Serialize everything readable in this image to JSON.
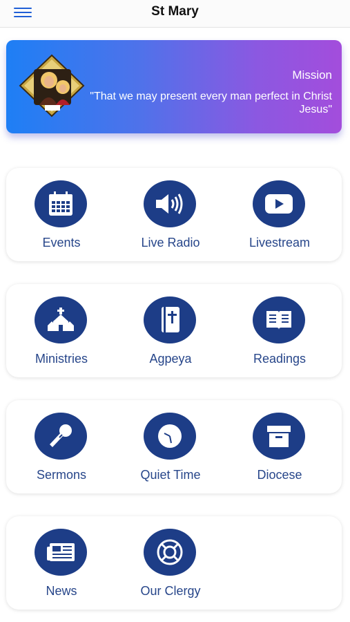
{
  "header": {
    "title": "St Mary",
    "menu_icon": "hamburger-menu-icon"
  },
  "banner": {
    "title": "Mission",
    "quote": "\"That we may present every man perfect in Christ Jesus\"",
    "icon": "icon-of-st-mary-image"
  },
  "colors": {
    "accent": "#1d3d87",
    "label": "#27468a",
    "gradient_start": "#1e7ff5",
    "gradient_end": "#a34ddc"
  },
  "grid": [
    [
      {
        "label": "Events",
        "icon": "calendar-icon"
      },
      {
        "label": "Live Radio",
        "icon": "speaker-icon"
      },
      {
        "label": "Livestream",
        "icon": "play-icon"
      }
    ],
    [
      {
        "label": "Ministries",
        "icon": "church-icon"
      },
      {
        "label": "Agpeya",
        "icon": "bible-icon"
      },
      {
        "label": "Readings",
        "icon": "open-book-icon"
      }
    ],
    [
      {
        "label": "Sermons",
        "icon": "microphone-icon"
      },
      {
        "label": "Quiet Time",
        "icon": "clock-icon"
      },
      {
        "label": "Diocese",
        "icon": "archive-box-icon"
      }
    ],
    [
      {
        "label": "News",
        "icon": "newspaper-icon"
      },
      {
        "label": "Our Clergy",
        "icon": "lifebuoy-icon"
      }
    ]
  ]
}
